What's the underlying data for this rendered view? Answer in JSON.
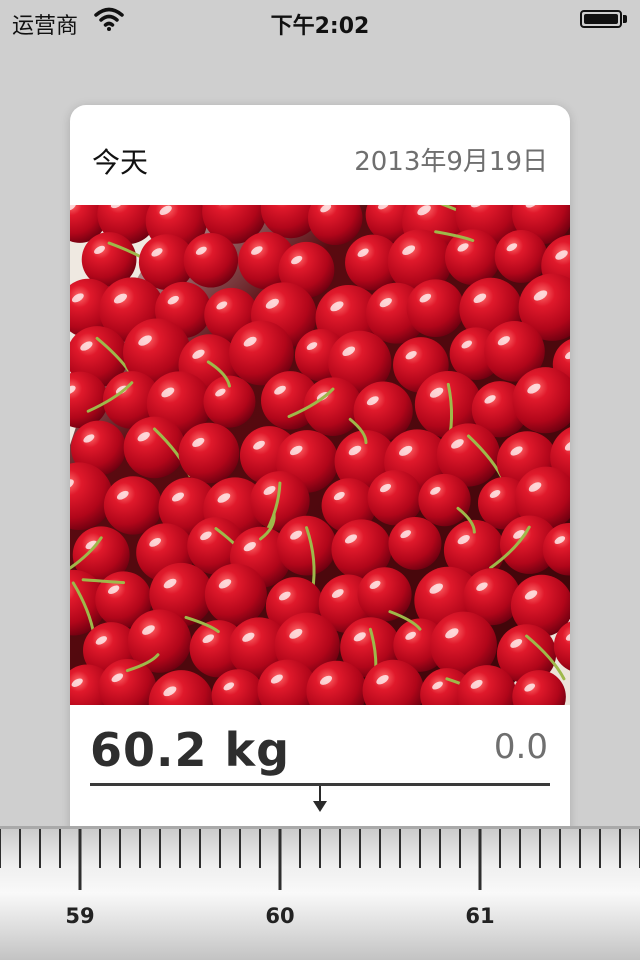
{
  "status_bar": {
    "carrier": "运营商",
    "time": "下午2:02",
    "wifi_icon": "wifi-icon",
    "battery_icon": "battery-icon"
  },
  "entry": {
    "day_label": "今天",
    "date": "2013年9月19日",
    "photo_description_icon": "cherries-photo",
    "weight": "60.2 kg",
    "delta": "0.0"
  },
  "ruler": {
    "labels": [
      "59",
      "60",
      "61"
    ],
    "selected_value": 60.2,
    "colors": {
      "tick": "#333333",
      "background": "#efefef"
    }
  }
}
